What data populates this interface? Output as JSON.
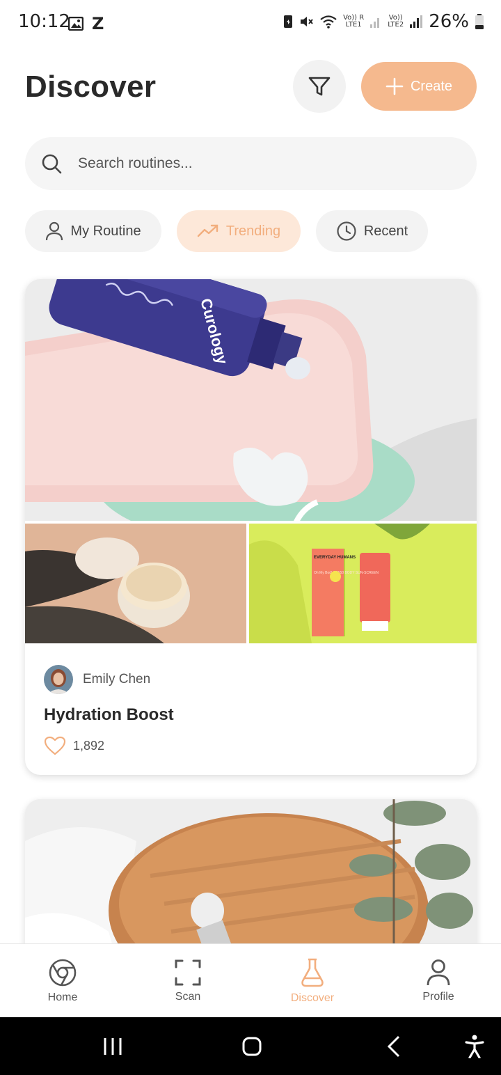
{
  "status_bar": {
    "time": "10:12",
    "carrier_z": "Z",
    "net1": "Vo)) R",
    "net1_sub": "LTE1",
    "net2": "Vo))",
    "net2_sub": "LTE2",
    "battery": "26%"
  },
  "header": {
    "title": "Discover",
    "create_label": "Create"
  },
  "search": {
    "placeholder": "Search routines..."
  },
  "chips": [
    {
      "label": "My Routine",
      "icon": "user-icon",
      "active": false
    },
    {
      "label": "Trending",
      "icon": "trending-icon",
      "active": true
    },
    {
      "label": "Recent",
      "icon": "clock-icon",
      "active": false
    }
  ],
  "cards": [
    {
      "author": "Emily Chen",
      "title": "Hydration Boost",
      "likes": "1,892",
      "main_image_text": "Curology",
      "right_image_brand": "EVERYDAY HUMANS",
      "right_image_text": "Oh My Bod! SPF50 BODY SUN-SCREEN"
    }
  ],
  "bottom_nav": [
    {
      "label": "Home",
      "icon": "home-icon",
      "active": false
    },
    {
      "label": "Scan",
      "icon": "scan-icon",
      "active": false
    },
    {
      "label": "Discover",
      "icon": "flask-icon",
      "active": true
    },
    {
      "label": "Profile",
      "icon": "profile-icon",
      "active": false
    }
  ],
  "colors": {
    "accent": "#f5b98e",
    "accent_light": "#fde8d9",
    "accent_text": "#f2ae7e"
  }
}
